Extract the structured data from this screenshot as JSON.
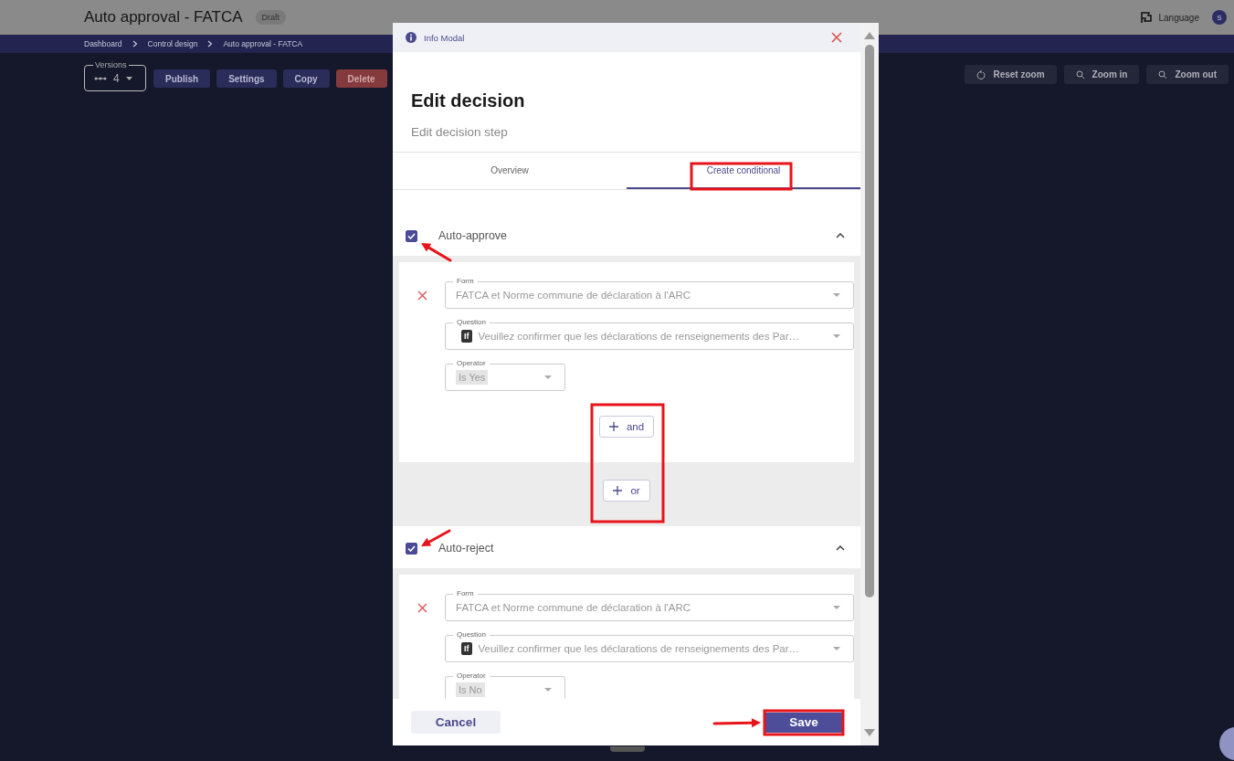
{
  "header": {
    "title": "Auto approval - FATCA",
    "badge": "Draft",
    "language": "Language",
    "avatar": "S"
  },
  "breadcrumbs": [
    "Dashboard",
    "Control design",
    "Auto approval - FATCA"
  ],
  "versions": {
    "label": "Versions",
    "value": "4"
  },
  "toolbar": [
    {
      "label": "Publish",
      "kind": "primary"
    },
    {
      "label": "Settings",
      "kind": "primary"
    },
    {
      "label": "Copy",
      "kind": "primary"
    },
    {
      "label": "Delete",
      "kind": "danger"
    }
  ],
  "zoom_buttons": [
    {
      "label": "Reset zoom",
      "kind": "reset"
    },
    {
      "label": "Zoom in",
      "kind": "zoom"
    },
    {
      "label": "Zoom out",
      "kind": "zoom"
    }
  ],
  "modal": {
    "header": "Info Modal",
    "title": "Edit decision",
    "subtitle": "Edit decision step",
    "tabs": [
      {
        "label": "Overview",
        "selected": false
      },
      {
        "label": "Create conditional",
        "selected": true
      }
    ],
    "sections": [
      {
        "label": "Auto-approve",
        "checked": true,
        "expanded": true,
        "form": {
          "label": "Form",
          "value": "FATCA et Norme commune de déclaration à l'ARC"
        },
        "question": {
          "label": "Question",
          "badge": "If",
          "value": "Veuillez confirmer que les déclarations de renseignements des Par…"
        },
        "operator": {
          "label": "Operator",
          "value": "Is Yes"
        },
        "and_button": "and",
        "or_button": "or"
      },
      {
        "label": "Auto-reject",
        "checked": true,
        "expanded": true,
        "form": {
          "label": "Form",
          "value": "FATCA et Norme commune de déclaration à l'ARC"
        },
        "question": {
          "label": "Question",
          "badge": "If",
          "value": "Veuillez confirmer que les déclarations de renseignements des Par…"
        },
        "operator": {
          "label": "Operator",
          "value": "Is No"
        }
      }
    ],
    "cancel": "Cancel",
    "save": "Save"
  }
}
